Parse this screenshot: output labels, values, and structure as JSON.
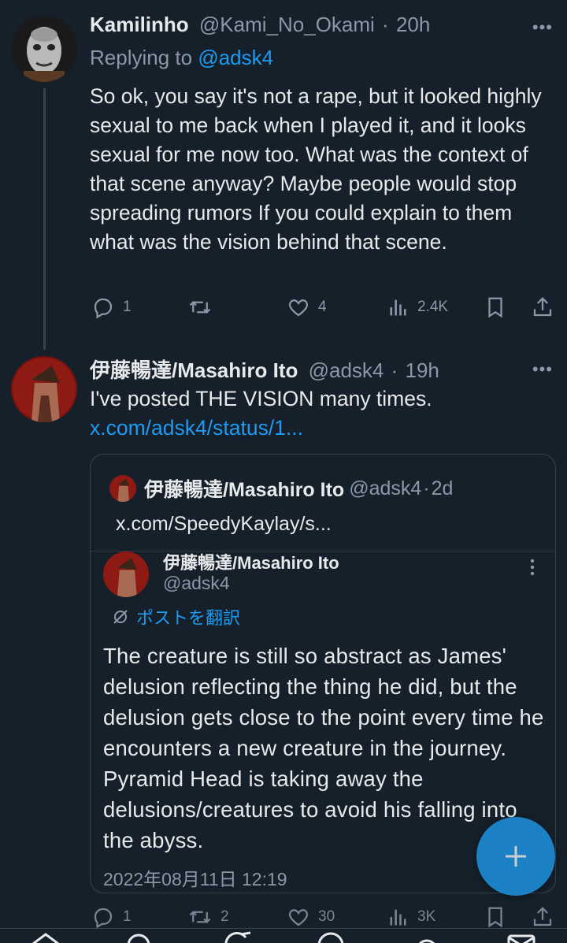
{
  "tweet1": {
    "display_name": "Kamilinho",
    "handle": "@Kami_No_Okami",
    "separator": "·",
    "time": "20h",
    "replying_prefix": "Replying to",
    "replying_to": "@adsk4",
    "text": "So ok, you say it's not a rape, but it looked highly sexual to me back when I played it, and it looks sexual for me now too. What was the context of that scene anyway? Maybe people would stop spreading rumors If you could explain to them what was the vision behind that scene.",
    "replies": "1",
    "retweets": "",
    "likes": "4",
    "views": "2.4K"
  },
  "tweet2": {
    "display_name": "伊藤暢達/Masahiro Ito",
    "handle": "@adsk4",
    "separator": "·",
    "time": "19h",
    "text": "I've posted THE VISION many times.",
    "link": "x.com/adsk4/status/1...",
    "replies": "1",
    "retweets": "2",
    "likes": "30",
    "views": "3K"
  },
  "quote": {
    "display_name": "伊藤暢達/Masahiro Ito",
    "handle": "@adsk4",
    "separator": "·",
    "time": "2d",
    "link_text": "x.com/SpeedyKaylay/s...",
    "embed": {
      "display_name": "伊藤暢達/Masahiro Ito",
      "handle": "@adsk4",
      "translate_label": "ポストを翻訳",
      "text": "The creature is still so abstract as James' delusion reflecting the thing he did, but the delusion gets close to the point every time he encounters a new creature in the journey. Pyramid Head is taking away the delusions/creatures to avoid his falling into the abyss.",
      "date": "2022年08月11日 12:19"
    }
  },
  "more_label": "•••",
  "colors": {
    "background": "#15202b",
    "text": "#e7e9ea",
    "muted": "#8b98a5",
    "accent": "#1d9bf0",
    "border": "#38444d"
  },
  "icons": [
    "reply-icon",
    "retweet-icon",
    "like-icon",
    "views-icon",
    "bookmark-icon",
    "share-icon",
    "compose-icon",
    "home-icon",
    "search-icon",
    "grok-icon",
    "spaces-icon",
    "notifications-icon",
    "messages-icon",
    "translate-icon"
  ]
}
